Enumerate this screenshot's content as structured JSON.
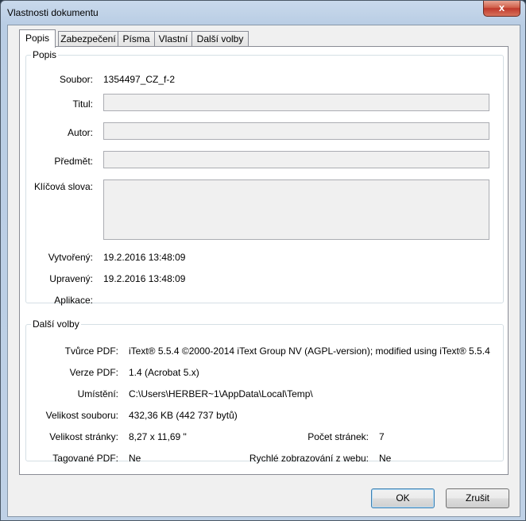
{
  "window": {
    "title": "Vlastnosti dokumentu",
    "close_glyph": "x"
  },
  "tabs": [
    {
      "label": "Popis",
      "active": true
    },
    {
      "label": "Zabezpečení",
      "active": false
    },
    {
      "label": "Písma",
      "active": false
    },
    {
      "label": "Vlastní",
      "active": false
    },
    {
      "label": "Další volby",
      "active": false
    }
  ],
  "description": {
    "legend": "Popis",
    "file_label": "Soubor:",
    "file_value": "1354497_CZ_f-2",
    "title_label": "Titul:",
    "title_value": "",
    "author_label": "Autor:",
    "author_value": "",
    "subject_label": "Předmět:",
    "subject_value": "",
    "keywords_label": "Klíčová slova:",
    "keywords_value": "",
    "created_label": "Vytvořený:",
    "created_value": "19.2.2016 13:48:09",
    "modified_label": "Upravený:",
    "modified_value": "19.2.2016 13:48:09",
    "application_label": "Aplikace:",
    "application_value": ""
  },
  "advanced": {
    "legend": "Další volby",
    "producer_label": "Tvůrce PDF:",
    "producer_value": "iText® 5.5.4 ©2000-2014 iText Group NV (AGPL-version); modified using iText® 5.5.4",
    "version_label": "Verze PDF:",
    "version_value": "1.4 (Acrobat 5.x)",
    "location_label": "Umístění:",
    "location_value": "C:\\Users\\HERBER~1\\AppData\\Local\\Temp\\",
    "filesize_label": "Velikost souboru:",
    "filesize_value": "432,36 KB (442 737 bytů)",
    "pagesize_label": "Velikost stránky:",
    "pagesize_value": "8,27 x 11,69 \"",
    "pagecount_label": "Počet stránek:",
    "pagecount_value": "7",
    "tagged_label": "Tagované PDF:",
    "tagged_value": "Ne",
    "fastweb_label": "Rychlé zobrazování z webu:",
    "fastweb_value": "Ne"
  },
  "buttons": {
    "ok": "OK",
    "cancel": "Zrušit"
  }
}
